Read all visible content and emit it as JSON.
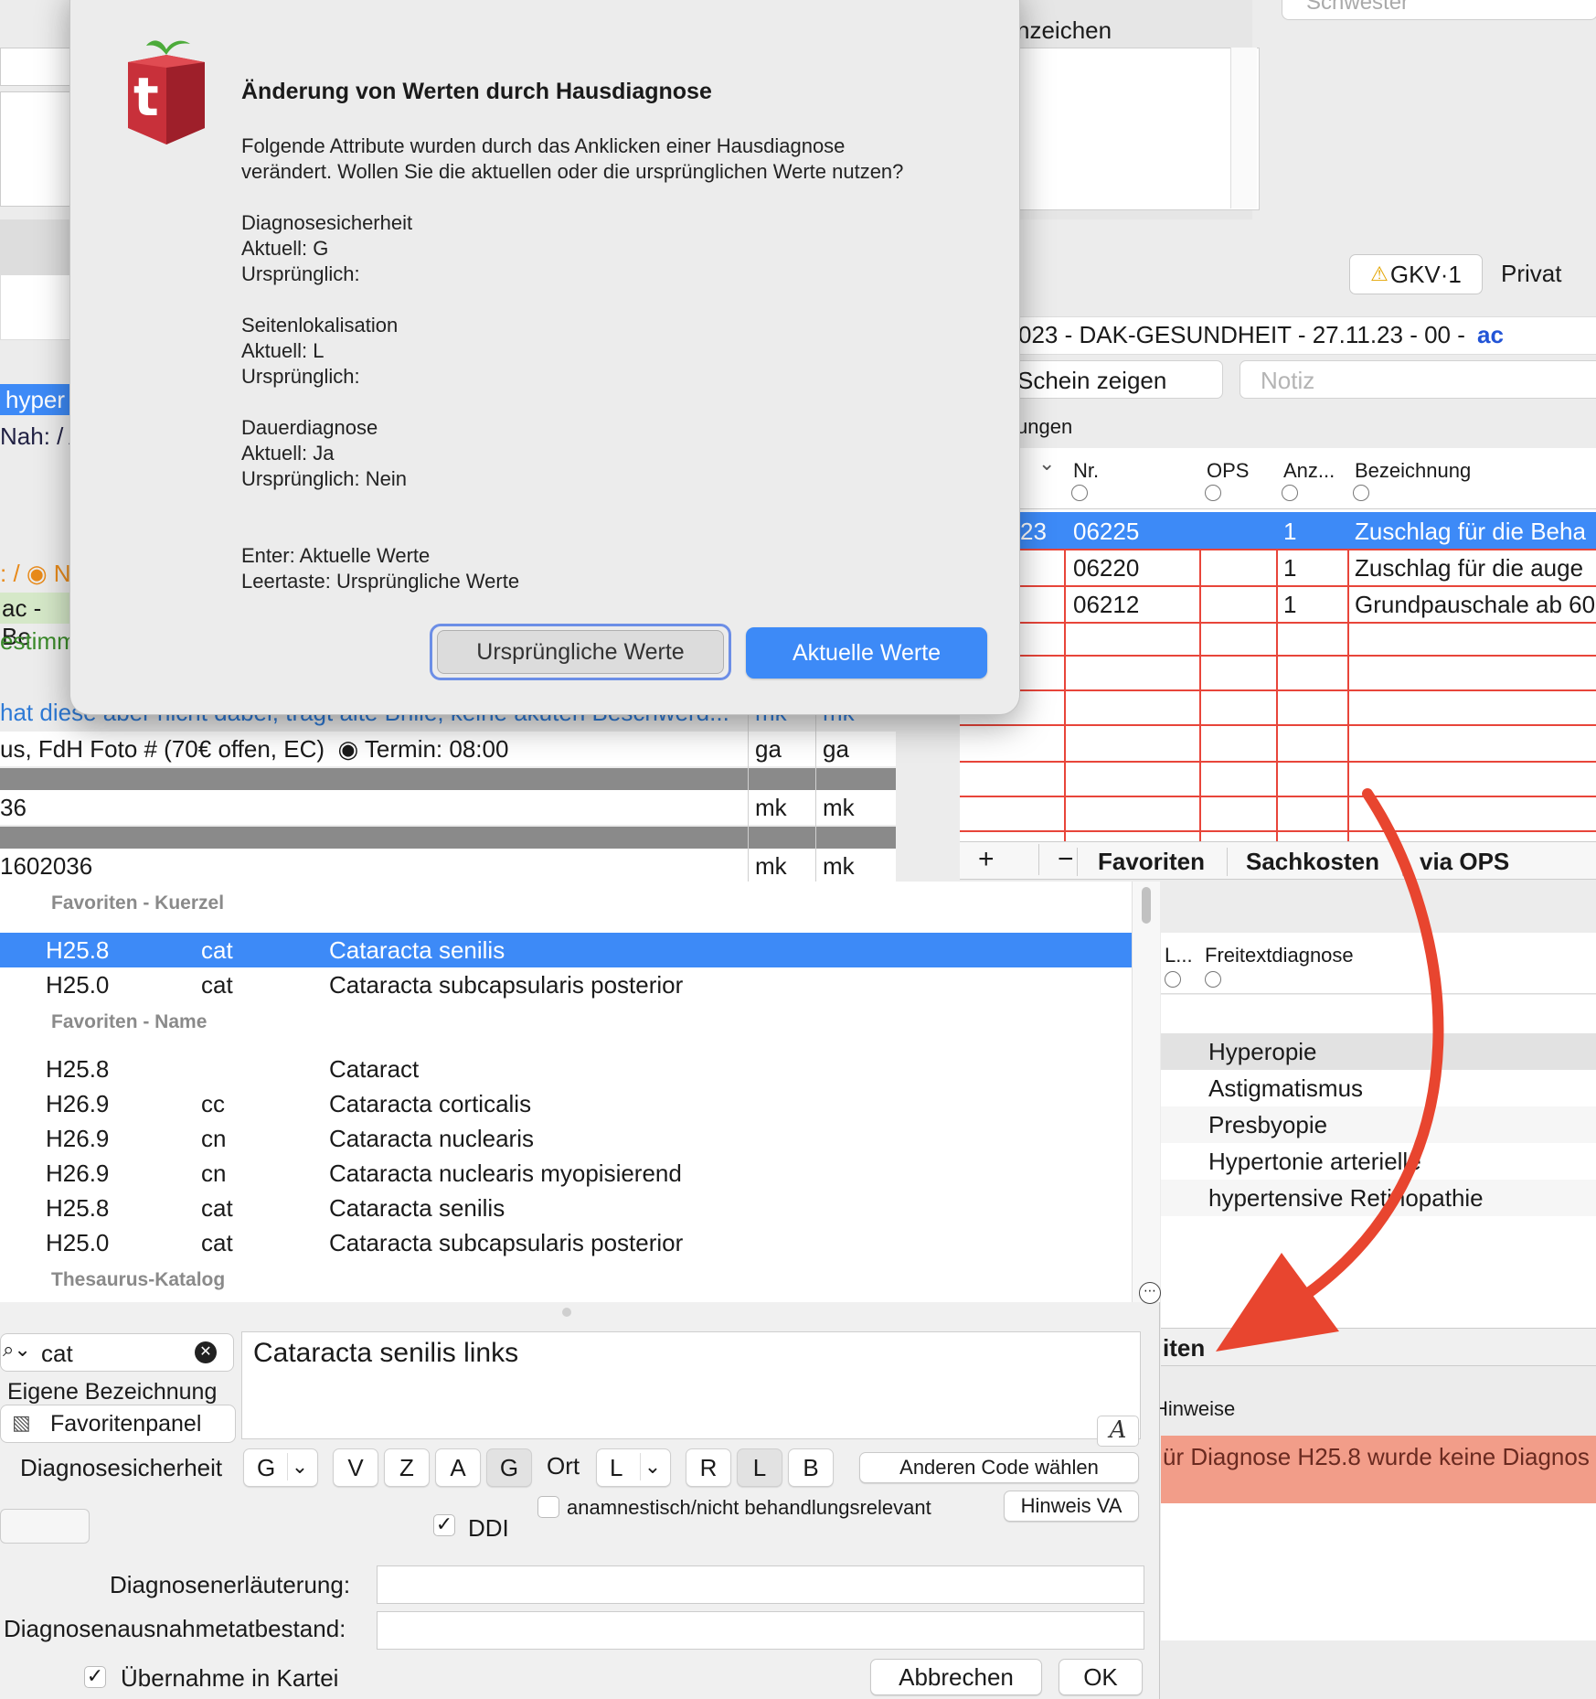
{
  "dialog": {
    "title": "Änderung von Werten durch Hausdiagnose",
    "message": "Folgende Attribute wurden durch das Anklicken einer Hausdiagnose\nverändert. Wollen Sie die aktuellen oder die ursprünglichen Werte nutzen?",
    "block1": "Diagnosesicherheit\nAktuell: G\nUrsprünglich:",
    "block2": "Seitenlokalisation\nAktuell: L\nUrsprünglich:",
    "block3": "Dauerdiagnose\nAktuell: Ja\nUrsprünglich: Nein",
    "hints": "Enter: Aktuelle Werte\nLeertaste: Ursprüngliche Werte",
    "btn_original": "Ursprüngliche Werte",
    "btn_current": "Aktuelle Werte",
    "logo_letter": "t"
  },
  "top_right": {
    "anzeichen_label": "nzeichen",
    "schwester_placeholder": "Schwester",
    "tab_gkv": "GKV·1",
    "tab_privat": "Privat",
    "insurance_line_prefix": "023 - DAK-GESUNDHEIT - 27.11.23 - 00 - ",
    "insurance_line_user": "ac",
    "schein_button": "Schein zeigen",
    "notiz_placeholder": "Notiz",
    "section_label": "ungen"
  },
  "services_table": {
    "headers": [
      "Nr.",
      "OPS",
      "Anz...",
      "Bezeichnung"
    ],
    "rows": [
      {
        "date": "23",
        "nr": "06225",
        "ops": "",
        "anz": "1",
        "bez": "Zuschlag für die Beha"
      },
      {
        "date": "",
        "nr": "06220",
        "ops": "",
        "anz": "1",
        "bez": "Zuschlag für die auge"
      },
      {
        "date": "",
        "nr": "06212",
        "ops": "",
        "anz": "1",
        "bez": "Grundpauschale ab 60"
      }
    ],
    "toolbar": {
      "add": "+",
      "remove": "−",
      "fav": "Favoriten",
      "sach": "Sachkosten",
      "ops": "via OPS"
    }
  },
  "left_bg": {
    "hyper": "hyper",
    "nah": "Nah: / A",
    "orange": ": / ◉ N",
    "ac_be": "ac - Be",
    "estimmt": "estimmt",
    "blue_line": "hat diese aber nicht dabei, trägt alte Brille, keine akuten Beschwerd...",
    "blue_init1": "mk",
    "blue_init2": "mk",
    "line_foto": "us, FdH Foto # (70€ offen, EC)  ◉ Termin: 08:00",
    "foto_init1": "ga",
    "foto_init2": "ga",
    "line_36": "36",
    "l36_init1": "mk",
    "l36_init2": "mk",
    "line_1602036": "1602036",
    "l16_init1": "mk",
    "l16_init2": "mk"
  },
  "favorites": {
    "section_kuerzel": "Favoriten - Kuerzel",
    "kuerzel_rows": [
      {
        "code": "H25.8",
        "short": "cat",
        "name": "Cataracta senilis"
      },
      {
        "code": "H25.0",
        "short": "cat",
        "name": "Cataracta subcapsularis posterior"
      }
    ],
    "section_name": "Favoriten - Name",
    "name_rows": [
      {
        "code": "H25.8",
        "short": "",
        "name": "Cataract"
      },
      {
        "code": "H26.9",
        "short": "cc",
        "name": "Cataracta corticalis"
      },
      {
        "code": "H26.9",
        "short": "cn",
        "name": "Cataracta nuclearis"
      },
      {
        "code": "H26.9",
        "short": "cn",
        "name": "Cataracta nuclearis myopisierend"
      },
      {
        "code": "H25.8",
        "short": "cat",
        "name": "Cataracta senilis"
      },
      {
        "code": "H25.0",
        "short": "cat",
        "name": "Cataracta subcapsularis posterior"
      }
    ],
    "section_thesaurus": "Thesaurus-Katalog"
  },
  "diag_right": {
    "header_l": "L...",
    "header_freitext": "Freitextdiagnose",
    "items": [
      "Hyperopie",
      "Astigmatismus",
      "Presbyopie",
      "Hypertonie arterielle",
      "hypertensive Retinopathie"
    ],
    "tab_label": "iten",
    "hinweise_label": "Hinweise",
    "warning": "ür Diagnose H25.8 wurde keine Diagnos"
  },
  "editor": {
    "search_value": "cat",
    "option_eigene": "Eigene Bezeichnung",
    "option_favpanel": "Favoritenpanel",
    "diagnosis_text": "Cataracta senilis links",
    "sicherheit_label": "Diagnosesicherheit",
    "sicherheit_value": "G",
    "seg_vzag": [
      "V",
      "Z",
      "A",
      "G"
    ],
    "ort_label": "Ort",
    "ort_value": "L",
    "seg_rlb": [
      "R",
      "L",
      "B"
    ],
    "btn_anderer_code": "Anderen Code wählen",
    "btn_hinweis_va": "Hinweis VA",
    "anamnestisch_label": "anamnestisch/nicht behandlungsrelevant",
    "ddi_label": "DDI",
    "erlaeuterung_label": "Diagnosenerläuterung:",
    "ausnahme_label": "Diagnosenausnahmetatbestand:",
    "uebernahme_label": "Übernahme in Kartei",
    "btn_abbrechen": "Abbrechen",
    "btn_ok": "OK",
    "font_icon_letter": "A"
  },
  "colors": {
    "selection_blue": "#3d8af7",
    "primary_button": "#3d8af7",
    "grid_red": "#e8453a",
    "warning_bg": "#f29d89",
    "arrow_red": "#e8452f",
    "logo_red": "#c8303a"
  }
}
